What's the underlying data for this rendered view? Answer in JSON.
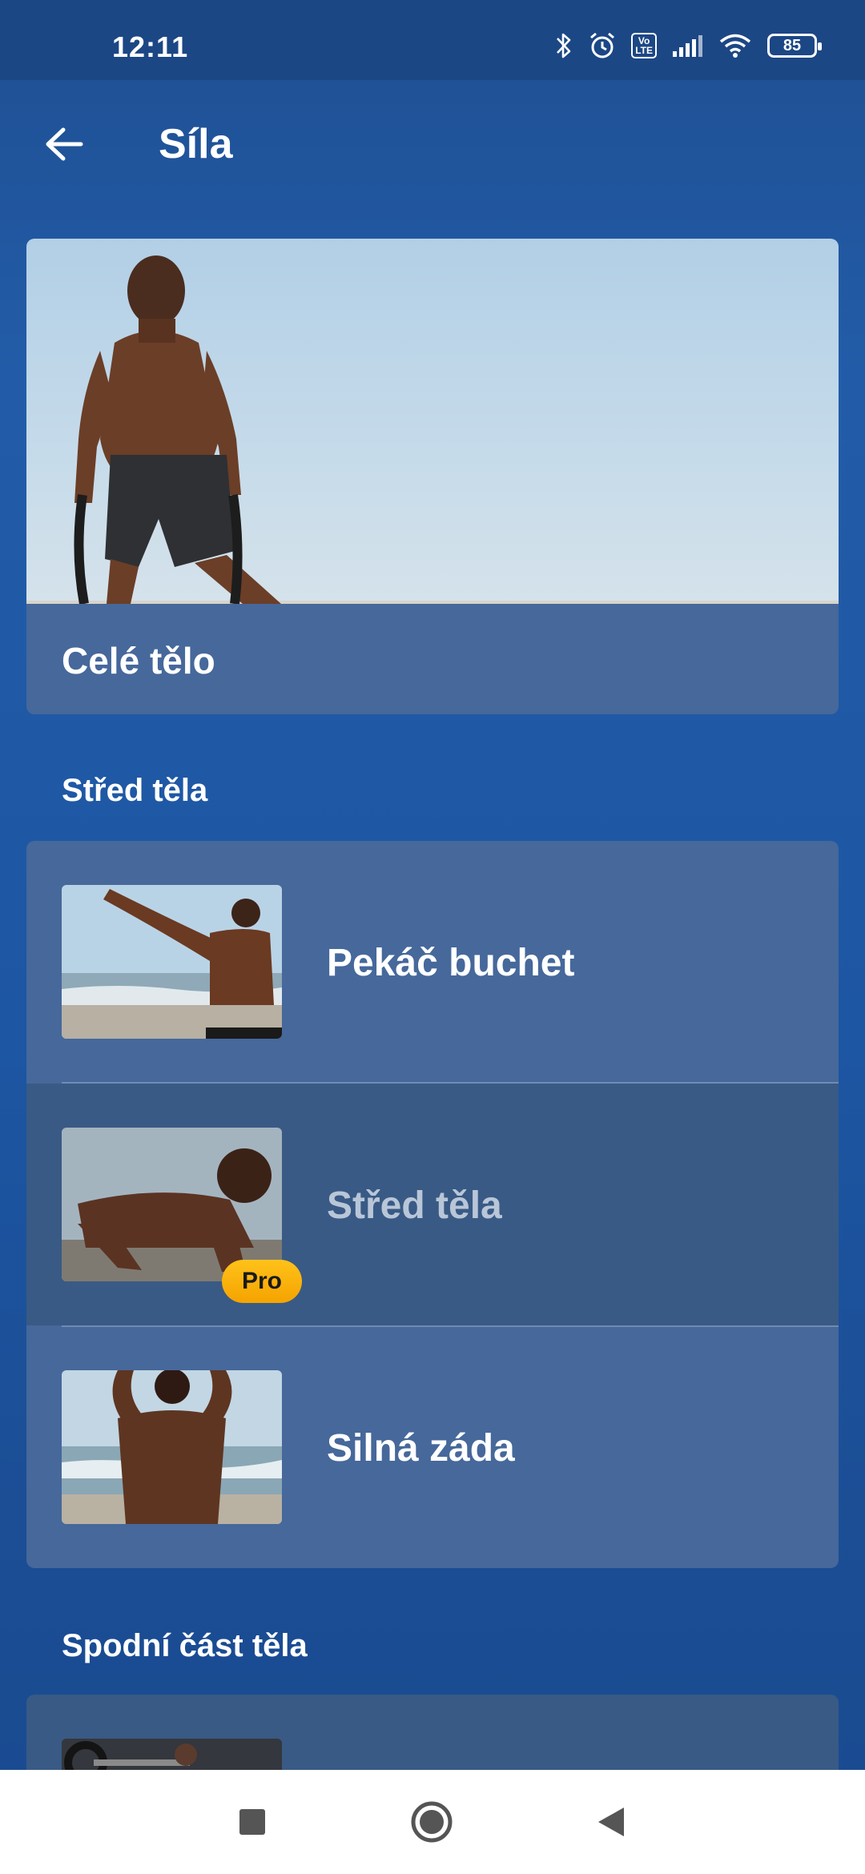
{
  "status_bar": {
    "time": "12:11",
    "battery": "85",
    "volte": "Vo\nLTE",
    "icons": [
      "bluetooth-icon",
      "alarm-icon",
      "volte-icon",
      "signal-icon",
      "wifi-icon",
      "battery-icon"
    ]
  },
  "header": {
    "title": "Síla",
    "back_icon": "arrow-left-icon"
  },
  "hero": {
    "caption": "Celé tělo"
  },
  "sections": [
    {
      "title": "Střed těla",
      "items": [
        {
          "label": "Pekáč buchet",
          "pro": false
        },
        {
          "label": "Střed těla",
          "pro": true
        },
        {
          "label": "Silná záda",
          "pro": false
        }
      ]
    },
    {
      "title": "Spodní část těla"
    }
  ],
  "badge": {
    "pro_label": "Pro"
  },
  "nav_bar": {
    "icons": [
      "recent-apps-icon",
      "home-icon",
      "back-icon"
    ]
  },
  "colors": {
    "background": "#1f55a0",
    "card": "#46689b",
    "card_dim": "#395a85",
    "pro_badge": "#f7a900"
  }
}
